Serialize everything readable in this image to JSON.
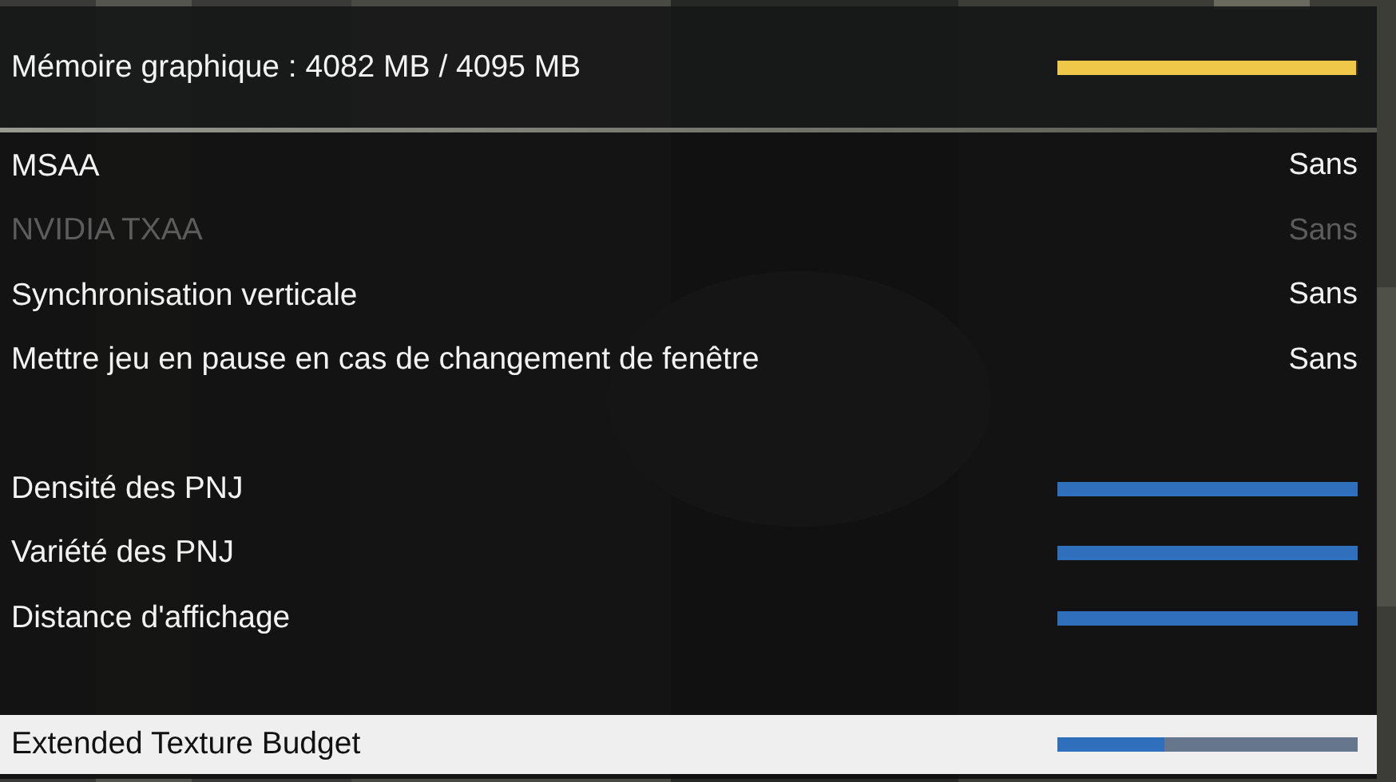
{
  "memory": {
    "label": "Mémoire graphique : 4082 MB / 4095 MB",
    "level": 0.997
  },
  "groups": [
    {
      "rows": [
        {
          "kind": "option",
          "label": "MSAA",
          "value": "Sans",
          "disabled": false,
          "selected": false
        },
        {
          "kind": "option",
          "label": "NVIDIA TXAA",
          "value": "Sans",
          "disabled": true,
          "selected": false
        },
        {
          "kind": "option",
          "label": "Synchronisation verticale",
          "value": "Sans",
          "disabled": false,
          "selected": false
        },
        {
          "kind": "option",
          "label": "Mettre jeu en pause en cas de changement de fenêtre",
          "value": "Sans",
          "disabled": false,
          "selected": false
        }
      ]
    },
    {
      "rows": [
        {
          "kind": "slider",
          "label": "Densité des PNJ",
          "level": 1,
          "disabled": false,
          "selected": false
        },
        {
          "kind": "slider",
          "label": "Variété des PNJ",
          "level": 1,
          "disabled": false,
          "selected": false
        },
        {
          "kind": "slider",
          "label": "Distance d'affichage",
          "level": 1,
          "disabled": false,
          "selected": false
        }
      ]
    },
    {
      "rows": [
        {
          "kind": "slider",
          "label": "Extended Texture Budget",
          "level": 0.355,
          "disabled": false,
          "selected": true
        }
      ]
    }
  ]
}
